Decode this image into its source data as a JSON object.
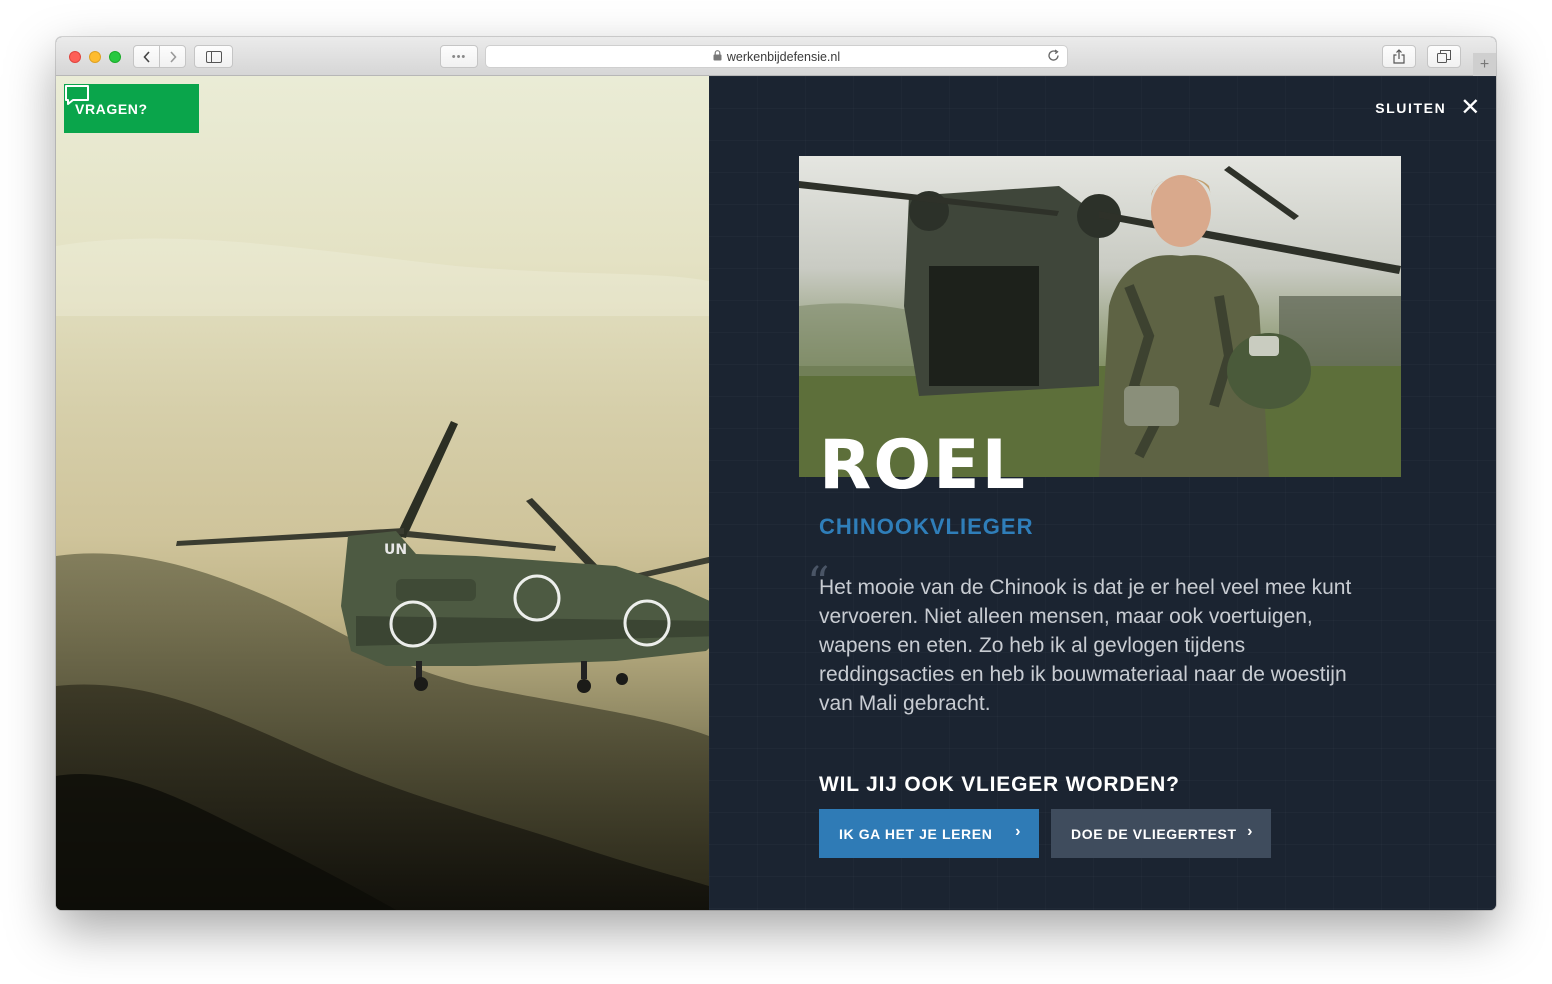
{
  "browser": {
    "url": "werkenbijdefensie.nl",
    "dots_label": "•••",
    "new_tab_label": "+"
  },
  "page": {
    "ask_button": {
      "label": "VRAGEN?"
    },
    "close": {
      "label": "SLUITEN",
      "icon": "✕"
    },
    "profile": {
      "name": "ROEL",
      "role": "CHINOOKVLIEGER",
      "quote_mark": "“",
      "quote": "Het mooie van de Chinook is dat je er heel veel mee kunt vervoeren. Niet alleen mensen, maar ook voertuigen, wapens en eten. Zo heb ik al gevlogen tijdens reddingsacties en heb ik bouwmateriaal naar de woestijn van Mali gebracht."
    },
    "cta": {
      "title": "WIL JIJ OOK VLIEGER WORDEN?",
      "buttons": [
        {
          "label": "IK GA HET JE LEREN",
          "chevron": "›"
        },
        {
          "label": "DOE DE VLIEGERTEST",
          "chevron": "›"
        }
      ]
    },
    "helicopter_marking": "UN"
  },
  "colors": {
    "ask_green": "#0aa54b",
    "panel_bg": "#1b2431",
    "role_blue": "#2f7eb9",
    "cta_primary": "#2f7bb6",
    "cta_secondary": "#3f4c5d"
  },
  "icons": {
    "chat": "chat-bubble-icon",
    "close": "close-icon",
    "lock": "lock-icon",
    "reload": "reload-icon",
    "share": "share-icon",
    "tabs": "tabs-icon",
    "sidebar": "sidebar-icon",
    "back": "chevron-left-icon",
    "forward": "chevron-right-icon",
    "chevron_right": "chevron-right-icon"
  }
}
